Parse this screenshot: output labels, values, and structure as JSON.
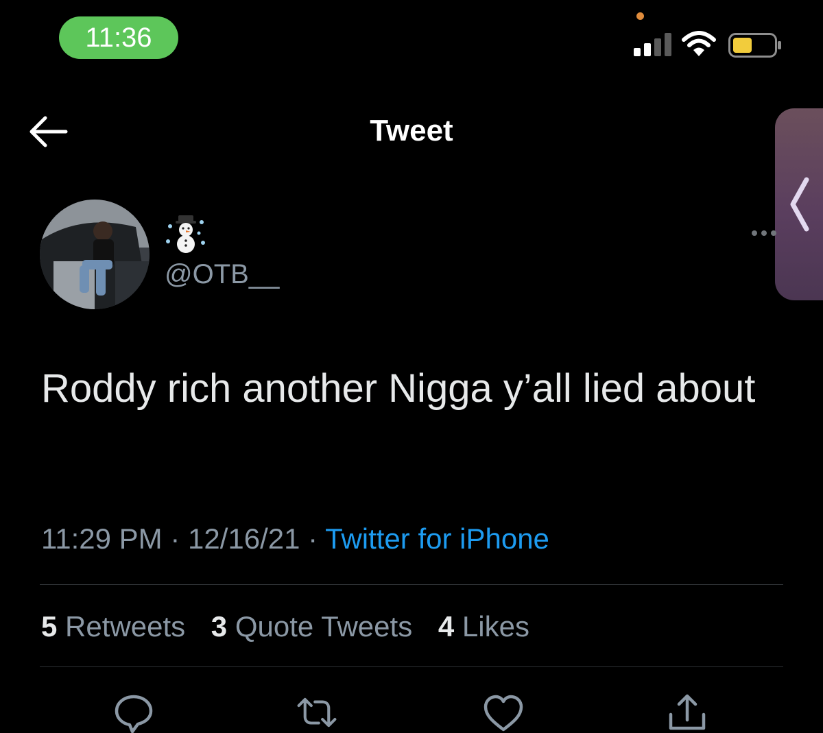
{
  "status_bar": {
    "time": "11:36",
    "accent_color": "#5dc65a"
  },
  "header": {
    "title": "Tweet",
    "back_icon": "arrow-left-icon"
  },
  "tweet": {
    "author": {
      "display_name_icon": "snowman-icon",
      "handle": "@OTB__"
    },
    "text": "Roddy rich another Nigga y’all lied about",
    "time": "11:29 PM",
    "separator": "·",
    "date": "12/16/21",
    "source": "Twitter for iPhone",
    "link_color": "#1d9bf0"
  },
  "stats": {
    "retweets_count": "5",
    "retweets_label": "Retweets",
    "quotes_count": "3",
    "quotes_label": "Quote Tweets",
    "likes_count": "4",
    "likes_label": "Likes"
  },
  "actions": [
    "reply-icon",
    "retweet-icon",
    "like-icon",
    "share-icon"
  ]
}
